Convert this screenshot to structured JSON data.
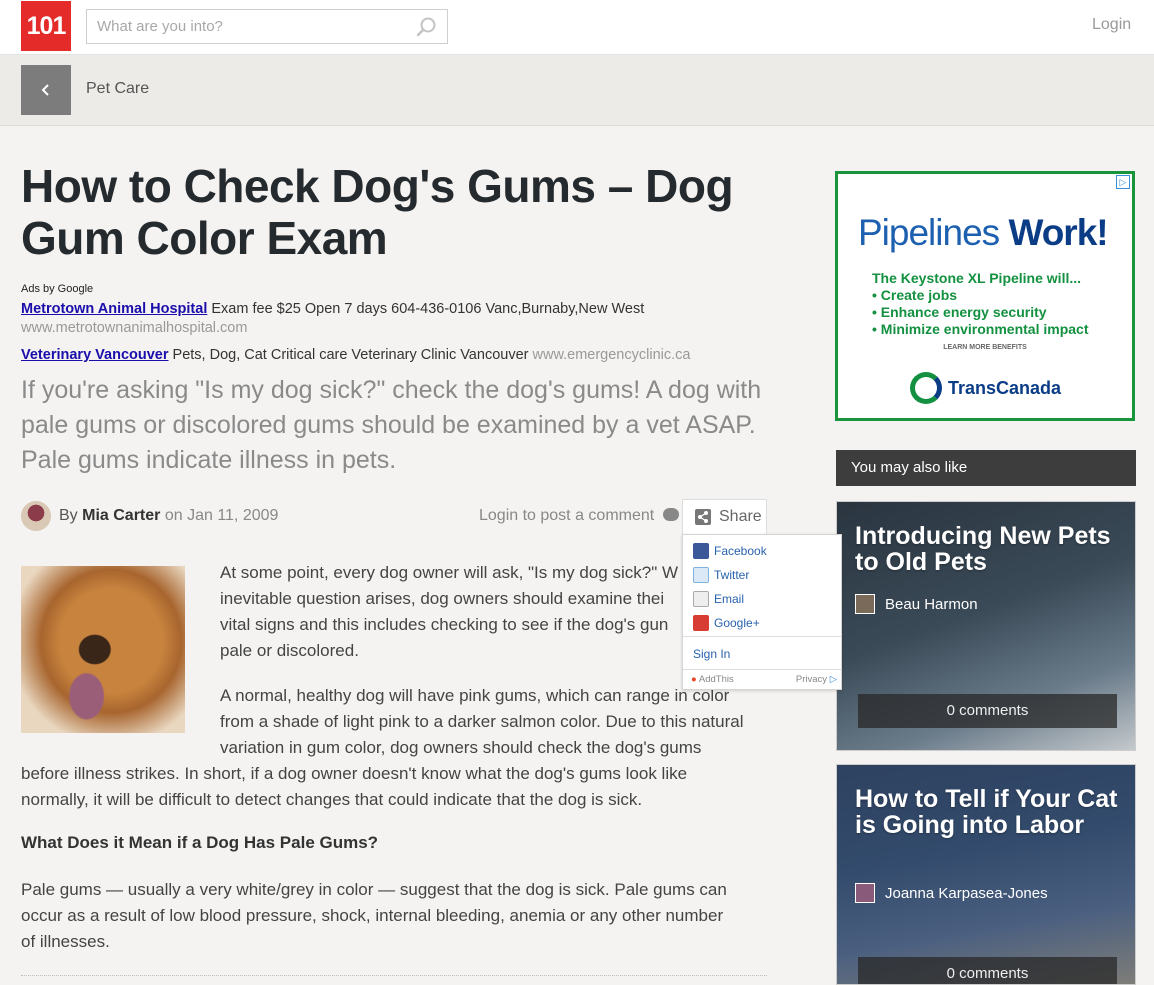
{
  "header": {
    "logo_text": "101",
    "search_placeholder": "What are you into?",
    "login_label": "Login"
  },
  "subbar": {
    "breadcrumb": "Pet Care"
  },
  "article": {
    "title": "How to Check Dog's Gums – Dog Gum Color Exam",
    "ads_label": "Ads by Google",
    "ads": [
      {
        "link": "Metrotown Animal Hospital",
        "text": "Exam fee $25 Open 7 days 604-436-0106 Vanc,Burnaby,New West",
        "url": "www.metrotownanimalhospital.com"
      },
      {
        "link": "Veterinary Vancouver",
        "text": "Pets, Dog, Cat Critical care Veterinary Clinic Vancouver",
        "url": "www.emergencyclinic.ca"
      }
    ],
    "lead": "If you're asking \"Is my dog sick?\" check the dog's gums! A dog with pale gums or discolored gums should be examined by a vet ASAP. Pale gums indicate illness in pets.",
    "byline": {
      "by": "By",
      "author": "Mia Carter",
      "on": "on",
      "date": "Jan 11, 2009"
    },
    "post_comment": "Login to post a comment",
    "share_label": "Share",
    "para1_lines": [
      "At some point, every dog owner will ask, \"Is my dog sick?\" W",
      "inevitable question arises, dog owners should examine thei",
      "vital signs and this includes checking to see if the dog's gun",
      "pale or discolored."
    ],
    "para2_lines": [
      "A normal, healthy dog will have pink gums, which can range in color",
      "from a shade of light pink to a darker salmon color. Due to this natural",
      "variation in gum color, dog owners should check the dog's gums",
      "before illness strikes. In short, if a dog owner doesn't know what the dog's gums look like",
      "normally, it will be difficult to detect changes that could indicate that the dog is sick."
    ],
    "subhead": "What Does it Mean if a Dog Has Pale Gums?",
    "para3_lines": [
      "Pale gums — usually a very white/grey in color — suggest that the dog is sick. Pale gums can",
      "occur as a result of low blood pressure, shock, internal bleeding, anemia or any other number",
      "of illnesses."
    ]
  },
  "share_menu": {
    "items": [
      "Facebook",
      "Twitter",
      "Email",
      "Google+"
    ],
    "sign_in": "Sign In",
    "addthis": "AddThis",
    "privacy": "Privacy"
  },
  "ad_banner": {
    "headline_a": "Pipelines",
    "headline_b": "Work!",
    "intro": "The Keystone XL Pipeline will...",
    "bullets": [
      "• Create jobs",
      "• Enhance energy security",
      "• Minimize environmental impact"
    ],
    "more": "LEARN MORE BENEFITS",
    "brand": "TransCanada"
  },
  "sidebar": {
    "heading": "You may also like",
    "cards": [
      {
        "title": "Introducing New Pets to Old Pets",
        "author": "Beau Harmon",
        "comments": "0 comments"
      },
      {
        "title": "How to Tell if Your Cat is Going into Labor",
        "author": "Joanna Karpasea-Jones",
        "comments": "0 comments"
      }
    ]
  },
  "colors": {
    "logo_red": "#e52a2a",
    "ad_link_blue": "#1a0dab",
    "ad_border_green": "#18953b",
    "share_link_blue": "#2962ad"
  }
}
